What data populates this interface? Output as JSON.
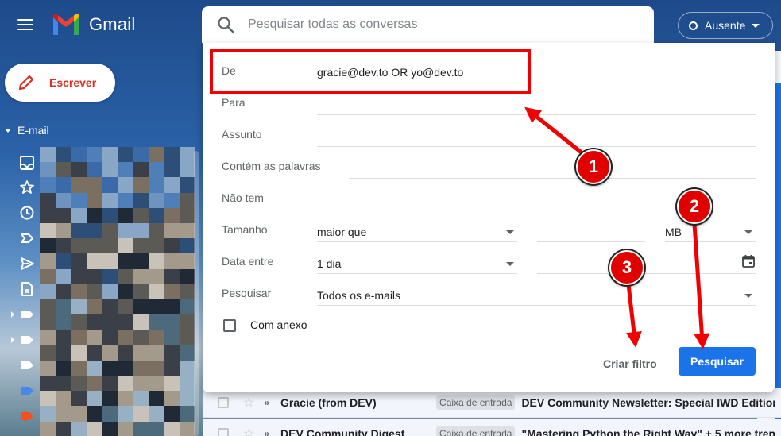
{
  "app": {
    "name": "Gmail",
    "status_label": "Ausente",
    "compose_label": "Escrever",
    "email_section_label": "E-mail"
  },
  "search": {
    "placeholder": "Pesquisar todas as conversas"
  },
  "advanced_search": {
    "from_label": "De",
    "from_value": "gracie@dev.to OR yo@dev.to",
    "to_label": "Para",
    "subject_label": "Assunto",
    "has_words_label": "Contém as palavras",
    "doesnt_have_label": "Não tem",
    "size_label": "Tamanho",
    "size_operator": "maior que",
    "size_unit": "MB",
    "date_label": "Data entre",
    "date_range": "1 dia",
    "search_in_label": "Pesquisar",
    "search_in_value": "Todos os e-mails",
    "attachment_label": "Com anexo",
    "create_filter_label": "Criar filtro",
    "search_button_label": "Pesquisar"
  },
  "emails": [
    {
      "sender": "Gracie (from DEV)",
      "label": "Caixa de entrada",
      "subject": "DEV Community Newsletter: Special IWD Edition"
    },
    {
      "sender": "DEV Community Digest",
      "label": "Caixa de entrada",
      "subject": "\"Mastering Python the Right Way\" + 5 more trend"
    }
  ],
  "annotations": {
    "badge_1": "1",
    "badge_2": "2",
    "badge_3": "3",
    "color": "#e00000"
  },
  "colors": {
    "accent": "#1a73e8",
    "compose_text": "#d93025",
    "header_bg": "#1e4a8a"
  }
}
